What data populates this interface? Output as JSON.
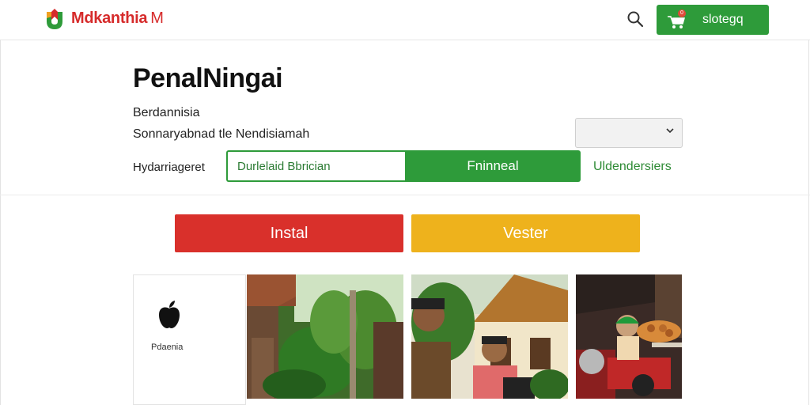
{
  "header": {
    "brand": "Mdkanthia",
    "brand_suffix": "M",
    "cart_label": "slotegq",
    "cart_badge": "0"
  },
  "main": {
    "title": "PenalNingai",
    "subtitle1": "Berdannisia",
    "subtitle2": "Sonnaryabnad tle Nendisiamah",
    "select_value": "",
    "field_label": "Hydarriageret",
    "field_value": "Durlelaid Bbrician",
    "field_button": "Fninneal",
    "field_link": "Uldendersiers",
    "primary_button": "Instal",
    "secondary_button": "Vester",
    "apple_card_label": "Pdaenia"
  },
  "colors": {
    "brand_red": "#d62b2b",
    "green": "#2e9b3a",
    "red_button": "#d9302b",
    "yellow_button": "#eeb21c"
  },
  "icons": {
    "search": "search-icon",
    "cart": "cart-icon",
    "apple": "apple-icon",
    "chevron": "chevron-down-icon"
  }
}
